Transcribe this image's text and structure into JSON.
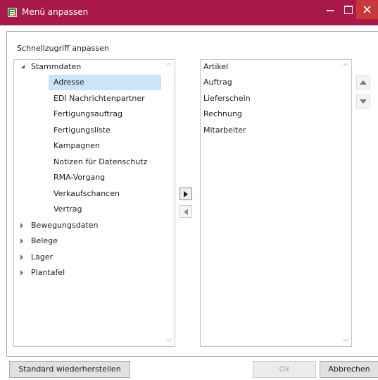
{
  "window": {
    "title": "Menü anpassen",
    "colors": {
      "titlebar": "#a8194a",
      "close": "#c7383b",
      "selection": "#cce4f7"
    }
  },
  "group_label": "Schnellzugriff anpassen",
  "tree": {
    "root_label": "Stammdaten",
    "children": [
      "Adresse",
      "EDI Nachrichtenpartner",
      "Fertigungsauftrag",
      "Fertigungsliste",
      "Kampagnen",
      "Notizen für Datenschutz",
      "RMA-Vorgang",
      "Verkaufschancen",
      "Vertrag"
    ],
    "selected": "Adresse",
    "collapsed": [
      "Bewegungsdaten",
      "Belege",
      "Lager",
      "Plantafel"
    ]
  },
  "selected_items": [
    "Artikel",
    "Auftrag",
    "Lieferschein",
    "Rechnung",
    "Mitarbeiter"
  ],
  "buttons": {
    "reset": "Standard wiederherstellen",
    "ok": "Ok",
    "cancel": "Abbrechen"
  }
}
